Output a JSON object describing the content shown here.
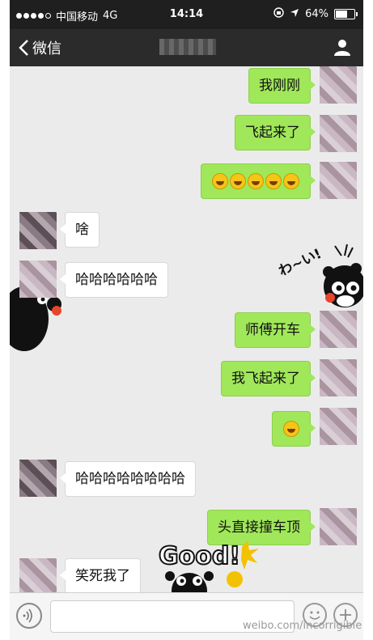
{
  "status_bar": {
    "carrier": "中国移动",
    "network": "4G",
    "time": "14:14",
    "battery": "64%",
    "battery_level": 0.64
  },
  "nav": {
    "back_label": "微信",
    "title": ""
  },
  "messages": [
    {
      "side": "out",
      "text": "我刚刚"
    },
    {
      "side": "out",
      "text": "飞起来了"
    },
    {
      "side": "out",
      "emoji_count": 5,
      "emoji": "laughing-crying-emoji"
    },
    {
      "side": "in",
      "text": "啥"
    },
    {
      "side": "in",
      "text": "哈哈哈哈哈哈"
    },
    {
      "side": "out",
      "text": "师傅开车"
    },
    {
      "side": "out",
      "text": "我飞起来了"
    },
    {
      "side": "out",
      "emoji_count": 1,
      "emoji": "laughing-crying-emoji"
    },
    {
      "side": "in",
      "text": "哈哈哈哈哈哈哈哈"
    },
    {
      "side": "out",
      "text": "头直接撞车顶"
    },
    {
      "side": "in",
      "text": "笑死我了"
    }
  ],
  "stickers": {
    "wai_text": "わ~い!",
    "good_text": "Good!"
  },
  "watermark": "weibo.com/incorrigible",
  "colors": {
    "outgoing_bubble": "#a0e75a",
    "incoming_bubble": "#ffffff",
    "nav_bg": "#2b2b2b",
    "chat_bg": "#ebebeb"
  }
}
